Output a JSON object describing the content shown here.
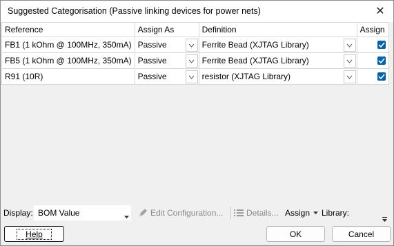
{
  "window": {
    "title": "Suggested Categorisation (Passive linking devices for power nets)",
    "close_glyph": "✕"
  },
  "grid": {
    "columns": {
      "reference": "Reference",
      "assign_as": "Assign As",
      "definition": "Definition",
      "assign": "Assign"
    },
    "rows": [
      {
        "reference": "FB1 (1 kOhm @ 100MHz, 350mA)",
        "assign_as": "Passive",
        "definition": "Ferrite Bead (XJTAG Library)",
        "assign": true
      },
      {
        "reference": "FB5 (1 kOhm @ 100MHz, 350mA)",
        "assign_as": "Passive",
        "definition": "Ferrite Bead (XJTAG Library)",
        "assign": true
      },
      {
        "reference": "R91 (10R)",
        "assign_as": "Passive",
        "definition": "resistor (XJTAG Library)",
        "assign": true
      }
    ]
  },
  "toolbar": {
    "display_label": "Display:",
    "display_value": "BOM Value",
    "edit_config_label": "Edit Configuration...",
    "details_label": "Details...",
    "assign_label": "Assign",
    "library_label": "Library:"
  },
  "buttons": {
    "help": "Help",
    "ok": "OK",
    "cancel": "Cancel"
  },
  "colors": {
    "accent": "#0063b1",
    "window_bg": "#f0f0f0"
  }
}
